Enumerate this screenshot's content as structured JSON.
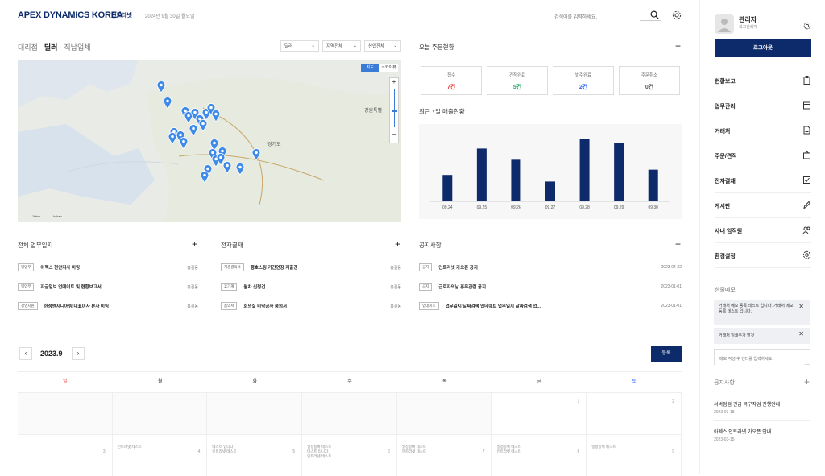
{
  "header": {
    "title": "APEX DYNAMICS KOREA",
    "subtitle": "인트라넷",
    "date": "2024년 9월 30일 월요일",
    "search_placeholder": "검색어를 입력하세요."
  },
  "tabs": [
    "대리점",
    "딜러",
    "직납업체"
  ],
  "dropdowns": [
    "딜러",
    "지역전체",
    "산업전체"
  ],
  "map": {
    "type_map": "지도",
    "type_sky": "스카이뷰",
    "region_label": "강원특별",
    "region2": "경기도",
    "scale": "10km",
    "brand": "kakao"
  },
  "orders": {
    "title": "오늘 주문현황",
    "stats": [
      {
        "label": "접수",
        "value": "7건",
        "color": "#e53935"
      },
      {
        "label": "견적완료",
        "value": "5건",
        "color": "#18a35a"
      },
      {
        "label": "발주완료",
        "value": "2건",
        "color": "#2962ff"
      },
      {
        "label": "주문취소",
        "value": "0건",
        "color": "#555555"
      }
    ]
  },
  "sales": {
    "title": "최근 7일 매출현황"
  },
  "chart_data": {
    "type": "bar",
    "categories": [
      "09.24",
      "09.25",
      "09.26",
      "09.27",
      "09.28",
      "09.29",
      "09.30"
    ],
    "values": [
      4,
      8,
      6.3,
      3,
      9.5,
      8.8,
      4.8
    ],
    "ylim": [
      0,
      10
    ],
    "color": "#0d2a6b"
  },
  "work": {
    "title": "전체 업무일지",
    "rows": [
      {
        "badge": "영업부",
        "title": "아펙스 천안지사 미팅",
        "right": "홍길동"
      },
      {
        "badge": "영업부",
        "title": "자금일보 업데이트 및 현황보고서 ...",
        "right": "홍길동"
      },
      {
        "badge": "경영지원",
        "title": "한성엔지니어링 대표이사 본사 미팅",
        "right": "홍길동"
      }
    ]
  },
  "approval": {
    "title": "전자결재",
    "rows": [
      {
        "badge": "지출결의서",
        "title": "행호스팅 기간연장 지출건",
        "right": "홍길동"
      },
      {
        "badge": "휴가계",
        "title": "월차 신청건",
        "right": "홍길동"
      },
      {
        "badge": "품의서",
        "title": "회의실 비닥공사 품의서",
        "right": "홍길동"
      }
    ]
  },
  "notice": {
    "title": "공지사항",
    "rows": [
      {
        "badge": "공지",
        "title": "인트라넷 가오픈 공지",
        "right": "2023-04-22"
      },
      {
        "badge": "공지",
        "title": "근로자의날 휴무관련 공지",
        "right": "2023-01-01"
      },
      {
        "badge": "업데이트",
        "title": "업무일지 날짜검색 업데이트 업무일지 날짜검색 업...",
        "right": "2023-01-01"
      }
    ]
  },
  "calendar": {
    "month": "2023.9",
    "register": "등록",
    "days": [
      "일",
      "월",
      "화",
      "수",
      "목",
      "금",
      "토"
    ],
    "row1": [
      "",
      "",
      "",
      "",
      "",
      "1",
      "2"
    ],
    "row2": [
      {
        "n": "3",
        "t": ""
      },
      {
        "n": "4",
        "t": "인트라넷 테스트"
      },
      {
        "n": "5",
        "t": "테스트 입니다.\n인트라넷 테스트"
      },
      {
        "n": "6",
        "t": "일정등록 테스트\n테스트 입니다.\n인트라넷 테스트"
      },
      {
        "n": "7",
        "t": "일정등록 테스트\n인트라넷 테스트"
      },
      {
        "n": "8",
        "t": "일정등록 테스트\n인트라넷 테스트"
      },
      {
        "n": "9",
        "t": "일정등록 테스트"
      }
    ]
  },
  "user": {
    "name": "관리자",
    "role": "최고관리자",
    "logout": "로그아웃"
  },
  "menu": [
    {
      "label": "현황보고",
      "icon": "clipboard-icon"
    },
    {
      "label": "업무관리",
      "icon": "calendar-icon"
    },
    {
      "label": "거래처",
      "icon": "document-icon"
    },
    {
      "label": "주문/견적",
      "icon": "bag-icon"
    },
    {
      "label": "전자결재",
      "icon": "checkbox-icon"
    },
    {
      "label": "게시판",
      "icon": "pencil-icon"
    },
    {
      "label": "사내 임직원",
      "icon": "users-icon"
    },
    {
      "label": "환경설정",
      "icon": "gear-icon"
    }
  ],
  "memo": {
    "title": "한줄메모",
    "items": [
      "거래처 메모 등록 테스트 입니다. 거래처 메모 등록 테스트 입니다.",
      "거래처 일쇄추가 할것"
    ],
    "placeholder": "메모 작성 후 엔터를 입력하세요."
  },
  "side_notice": {
    "title": "공지사항",
    "items": [
      {
        "title": "서버점검 긴급 복구작업 진행안내",
        "date": "2023-03-18"
      },
      {
        "title": "아펙스 인트라넷 가오픈 안내",
        "date": "2023-03-15"
      }
    ]
  }
}
